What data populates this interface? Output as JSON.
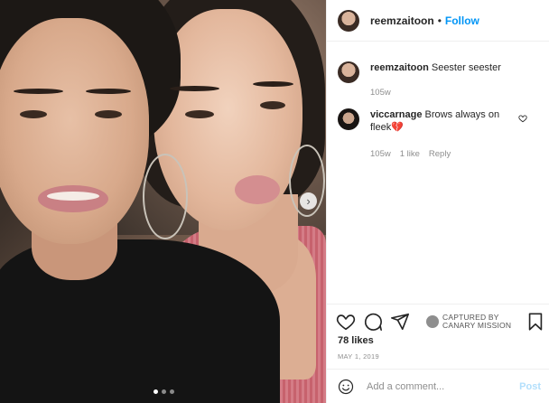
{
  "post": {
    "username": "reemzaitoon",
    "separator": "•",
    "follow_label": "Follow",
    "photo_alt": "",
    "nav_next_glyph": "›",
    "carousel": {
      "count": 3,
      "active_index": 0
    }
  },
  "comments": [
    {
      "username": "reemzaitoon",
      "text": "Seester seester",
      "age": "105w",
      "likes": "",
      "reply": ""
    },
    {
      "username": "viccarnage",
      "text": "Brows always on fleek💔",
      "age": "105w",
      "likes": "1 like",
      "reply": "Reply"
    }
  ],
  "actions": {
    "icons": [
      "heart-icon",
      "comment-icon",
      "share-icon",
      "bookmark-icon"
    ],
    "captured_line1": "CAPTURED BY",
    "captured_line2": "CANARY MISSION"
  },
  "likes": "78 likes",
  "date": "MAY 1, 2019",
  "composer": {
    "placeholder": "Add a comment...",
    "post_label": "Post"
  },
  "colors": {
    "accent": "#0095f6",
    "post_disabled": "#b2dffc",
    "muted": "#8e8e8e"
  }
}
